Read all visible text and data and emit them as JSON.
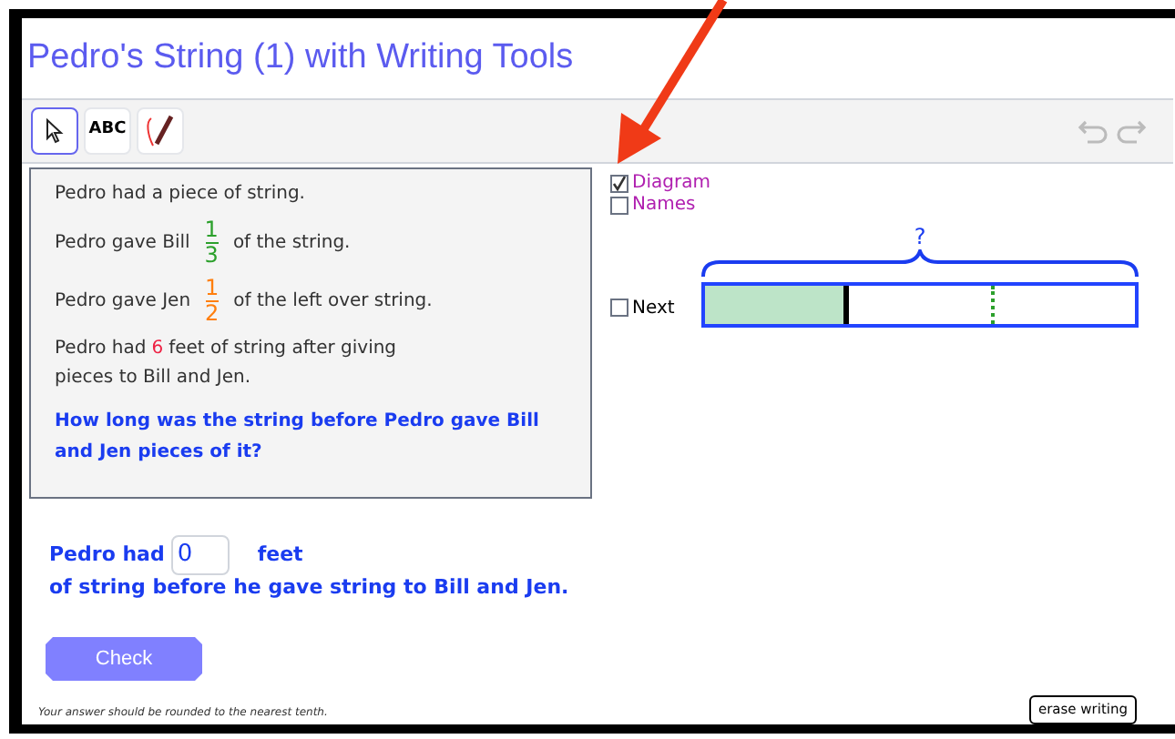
{
  "title": "Pedro's String (1) with Writing Tools",
  "toolbar": {
    "tools": [
      {
        "kind": "pointer",
        "selected": true
      },
      {
        "kind": "text",
        "label": "ABC",
        "selected": false
      },
      {
        "kind": "pen",
        "selected": false
      }
    ]
  },
  "problem": {
    "lines": [
      {
        "kind": "plain",
        "parts": [
          {
            "kind": "text",
            "text": "Pedro had a piece of string."
          }
        ]
      },
      {
        "kind": "plain",
        "parts": [
          {
            "kind": "text",
            "text": "Pedro gave Bill"
          },
          {
            "kind": "fraction",
            "numerator": "1",
            "denominator": "3",
            "color": "#2ca02c"
          },
          {
            "kind": "text",
            "text": "of the string."
          }
        ]
      },
      {
        "kind": "plain",
        "parts": [
          {
            "kind": "text",
            "text": "Pedro gave Jen"
          },
          {
            "kind": "fraction",
            "numerator": "1",
            "denominator": "2",
            "color": "#ff7f0e"
          },
          {
            "kind": "text",
            "text": "of the left over string."
          }
        ]
      },
      {
        "kind": "plain",
        "parts": [
          {
            "kind": "text",
            "text": "Pedro had"
          },
          {
            "kind": "number",
            "text": "6",
            "color": "#ee2244"
          },
          {
            "kind": "text",
            "text": "feet of string after giving"
          },
          {
            "kind": "line",
            "text": "pieces to Bill and Jen."
          }
        ]
      },
      {
        "kind": "question",
        "text": "How long was the string before Pedro gave Bill and Jen pieces of it?"
      }
    ]
  },
  "options": [
    {
      "label": "Diagram",
      "checked": true
    },
    {
      "label": "Names",
      "checked": false
    }
  ],
  "next": {
    "label": "Next",
    "checked": false
  },
  "diagram": {
    "total_label": "?",
    "level": 0.333
  },
  "answer": {
    "before": "Pedro had",
    "value": "0",
    "after": "feet",
    "line2": "of string before he gave string to Bill and Jen."
  },
  "check_button": "Check",
  "footnote": "Your answer should be rounded to the nearest tenth.",
  "erase_button": "erase writing"
}
